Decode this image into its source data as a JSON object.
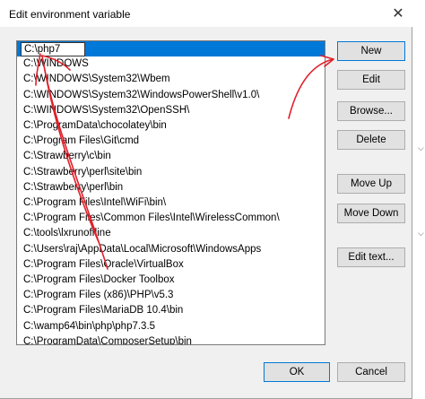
{
  "window": {
    "title": "Edit environment variable",
    "close_glyph": "✕"
  },
  "list": {
    "editing_value": "C:\\php7",
    "items": [
      "C:\\WINDOWS",
      "C:\\WINDOWS\\System32\\Wbem",
      "C:\\WINDOWS\\System32\\WindowsPowerShell\\v1.0\\",
      "C:\\WINDOWS\\System32\\OpenSSH\\",
      "C:\\ProgramData\\chocolatey\\bin",
      "C:\\Program Files\\Git\\cmd",
      "C:\\Strawberry\\c\\bin",
      "C:\\Strawberry\\perl\\site\\bin",
      "C:\\Strawberry\\perl\\bin",
      "C:\\Program Files\\Intel\\WiFi\\bin\\",
      "C:\\Program Files\\Common Files\\Intel\\WirelessCommon\\",
      "C:\\tools\\lxrunoffline",
      "C:\\Users\\raj\\AppData\\Local\\Microsoft\\WindowsApps",
      "C:\\Program Files\\Oracle\\VirtualBox",
      "C:\\Program Files\\Docker Toolbox",
      "C:\\Program Files (x86)\\PHP\\v5.3",
      "C:\\Program Files\\MariaDB 10.4\\bin",
      "C:\\wamp64\\bin\\php\\php7.3.5",
      "C:\\ProgramData\\ComposerSetup\\bin"
    ]
  },
  "buttons": {
    "new": "New",
    "edit": "Edit",
    "browse": "Browse...",
    "delete": "Delete",
    "move_up": "Move Up",
    "move_down": "Move Down",
    "edit_text": "Edit text...",
    "ok": "OK",
    "cancel": "Cancel"
  },
  "colors": {
    "selection": "#0078d7",
    "annotation": "#e0202a"
  }
}
